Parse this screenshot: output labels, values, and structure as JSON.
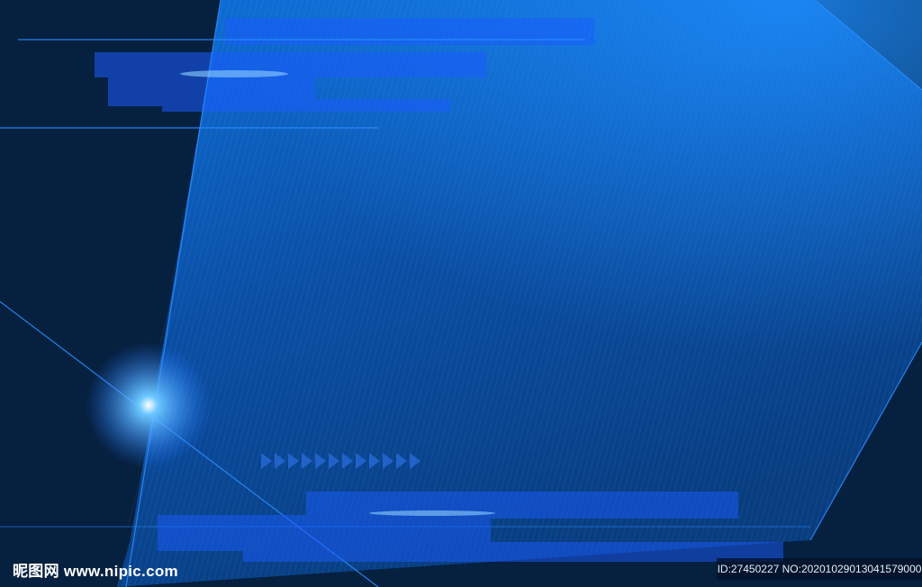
{
  "watermark": {
    "site": "昵图网 www.nipic.com",
    "id_line": "ID:27450227 NO:20201029013041579000"
  },
  "colors": {
    "background_dark": "#06203f",
    "panel_blue": "#0a56b0",
    "glow": "#3aa8ff"
  }
}
